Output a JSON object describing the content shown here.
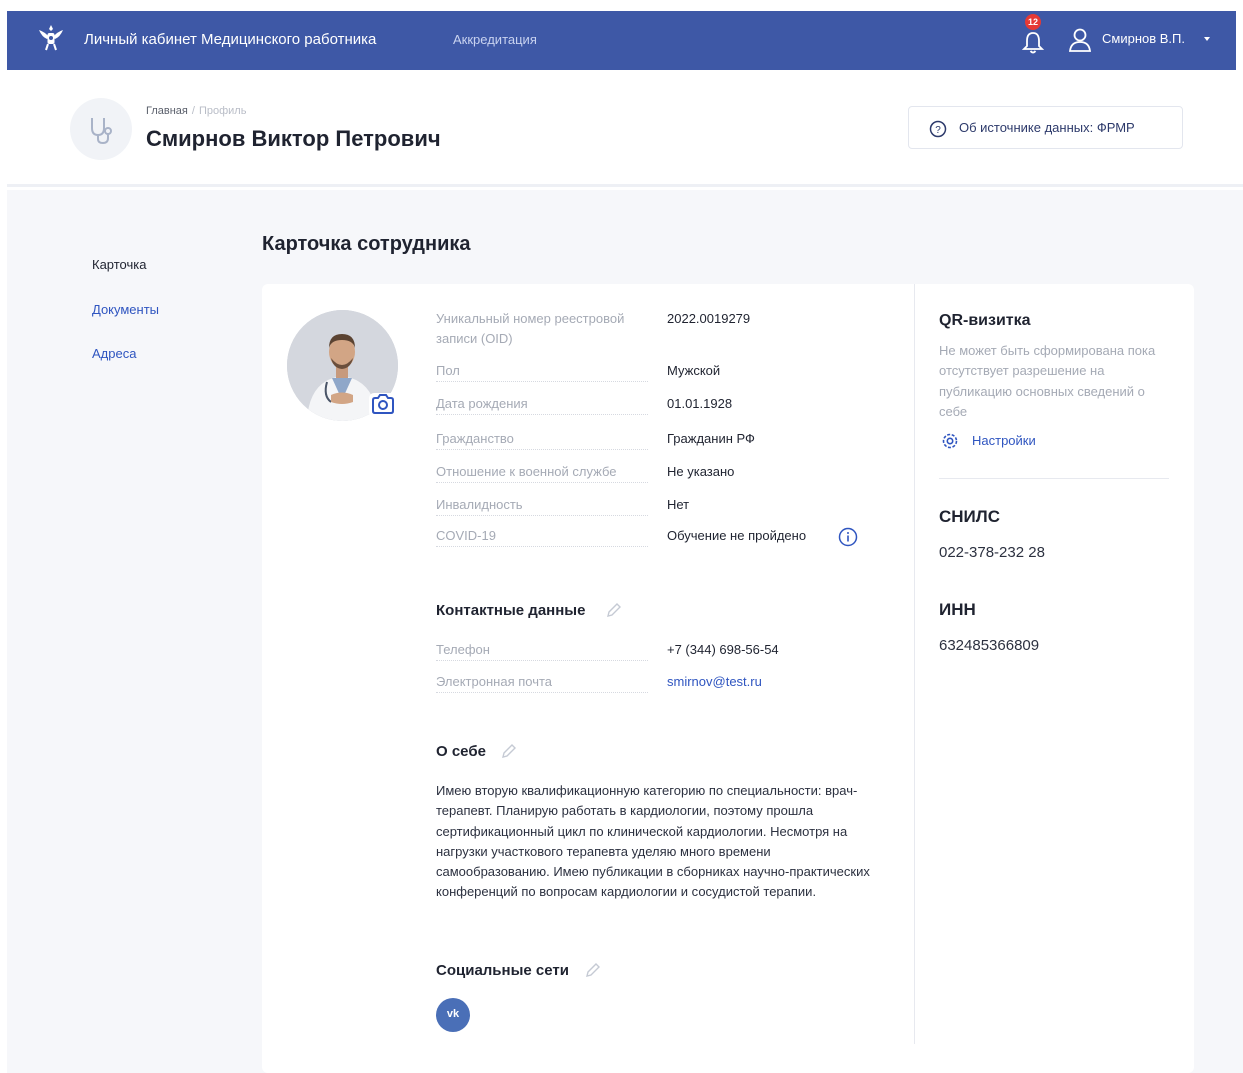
{
  "topbar": {
    "app_title": "Личный кабинет Медицинского работника",
    "nav_accreditation": "Аккредитация",
    "notifications_count": "12",
    "user_name": "Смирнов В.П.",
    "bg_color": "#3e58a6",
    "icons": [
      "emblem-icon",
      "bell-icon",
      "user-icon",
      "caret-down-icon"
    ]
  },
  "header": {
    "breadcrumb_home": "Главная",
    "breadcrumb_separator": "/",
    "breadcrumb_current": "Профиль",
    "full_name": "Смирнов Виктор Петрович",
    "source_button": "Об источнике данных: ФРМР"
  },
  "sidebar": {
    "items": [
      {
        "label": "Карточка",
        "active": true
      },
      {
        "label": "Документы",
        "active": false
      },
      {
        "label": "Адреса",
        "active": false
      }
    ]
  },
  "main": {
    "section_title": "Карточка сотрудника",
    "fields": [
      {
        "label": "Уникальный номер реестровой записи (OID)",
        "value": "2022.0019279"
      },
      {
        "label": "Пол",
        "value": "Мужской"
      },
      {
        "label": "Дата рождения",
        "value": "01.01.1928"
      },
      {
        "label": "Гражданство",
        "value": "Гражданин РФ"
      },
      {
        "label": "Отношение к военной службе",
        "value": "Не указано"
      },
      {
        "label": "Инвалидность",
        "value": "Нет"
      },
      {
        "label": "COVID-19",
        "value": "Обучение не пройдено"
      }
    ],
    "contacts": {
      "title": "Контактные данные",
      "fields": [
        {
          "label": "Телефон",
          "value": "+7 (344) 698-56-54"
        },
        {
          "label": "Электронная почта",
          "value": "smirnov@test.ru"
        }
      ]
    },
    "about": {
      "title": "О себе",
      "text": "Имею вторую квалификационную категорию по специальности: врач-терапевт. Планирую работать в кардиологии, поэтому прошла сертификационный цикл по клинической кардиологии. Несмотря на нагрузки участкового терапевта уделяю много времени самообразованию. Имею публикации в сборниках научно-практических конференций по вопросам кардиологии и сосудистой терапии."
    },
    "social": {
      "title": "Социальные сети",
      "vk_label": "vk"
    }
  },
  "right": {
    "qr_title": "QR-визитка",
    "qr_desc": "Не может быть сформирована пока отсутствует разрешение на публикацию основных сведений о себе",
    "settings_label": "Настройки",
    "snils_title": "СНИЛС",
    "snils_value": "022-378-232 28",
    "inn_title": "ИНН",
    "inn_value": "632485366809"
  },
  "colors": {
    "accent": "#2f55c0",
    "muted": "#a5aab5",
    "badge": "#e53935",
    "page_bg": "#f6f7fa"
  }
}
